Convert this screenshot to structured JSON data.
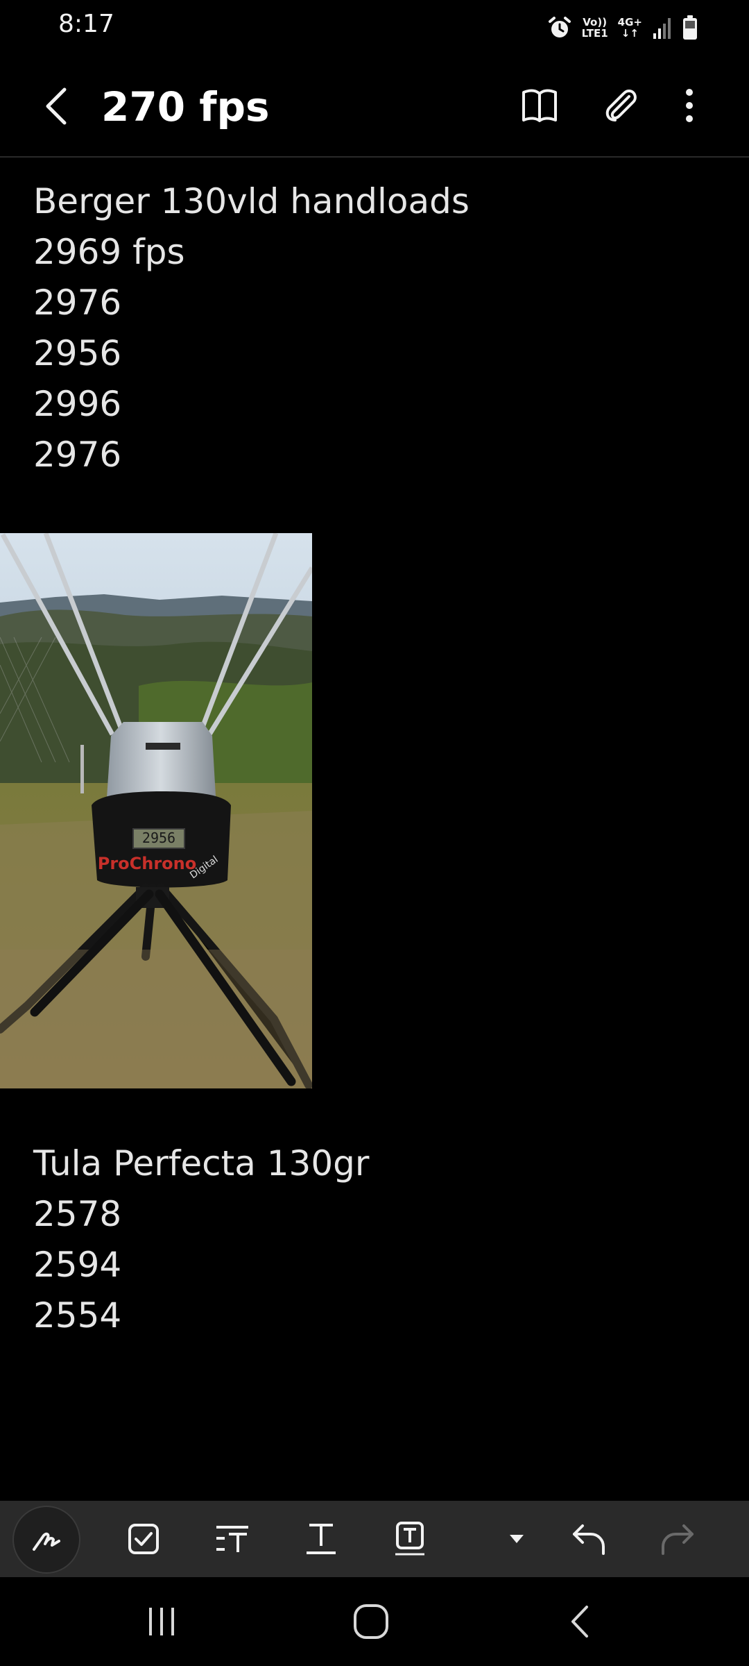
{
  "status_bar": {
    "time": "8:17",
    "network_top": "Vo))",
    "network_bottom": "LTE1",
    "data_type": "4G+",
    "icons": [
      "alarm-icon",
      "signal-icon",
      "battery-icon"
    ]
  },
  "header": {
    "title": "270 fps",
    "icons": [
      "back-icon",
      "reading-mode-icon",
      "attach-icon",
      "more-options-icon"
    ]
  },
  "note": {
    "section1": {
      "lines": [
        "Berger 130vld handloads",
        "2969 fps",
        "2976",
        "2956",
        "2996",
        "2976"
      ]
    },
    "photo": {
      "device_brand": "ProChrono",
      "device_sub": "Digital",
      "display_reading": "2956"
    },
    "section2": {
      "lines": [
        "Tula Perfecta 130gr",
        "2578",
        "2594",
        "2554"
      ]
    }
  },
  "toolbar": {
    "tools": [
      "handwriting-pen-icon",
      "checkbox-icon",
      "text-style-icon",
      "text-format-icon",
      "text-box-icon",
      "dropdown-arrow-icon",
      "undo-icon",
      "redo-icon"
    ],
    "accent_bg": "#2a2a2a"
  },
  "navbar": {
    "buttons": [
      "recent-apps-icon",
      "home-icon",
      "nav-back-icon"
    ]
  }
}
